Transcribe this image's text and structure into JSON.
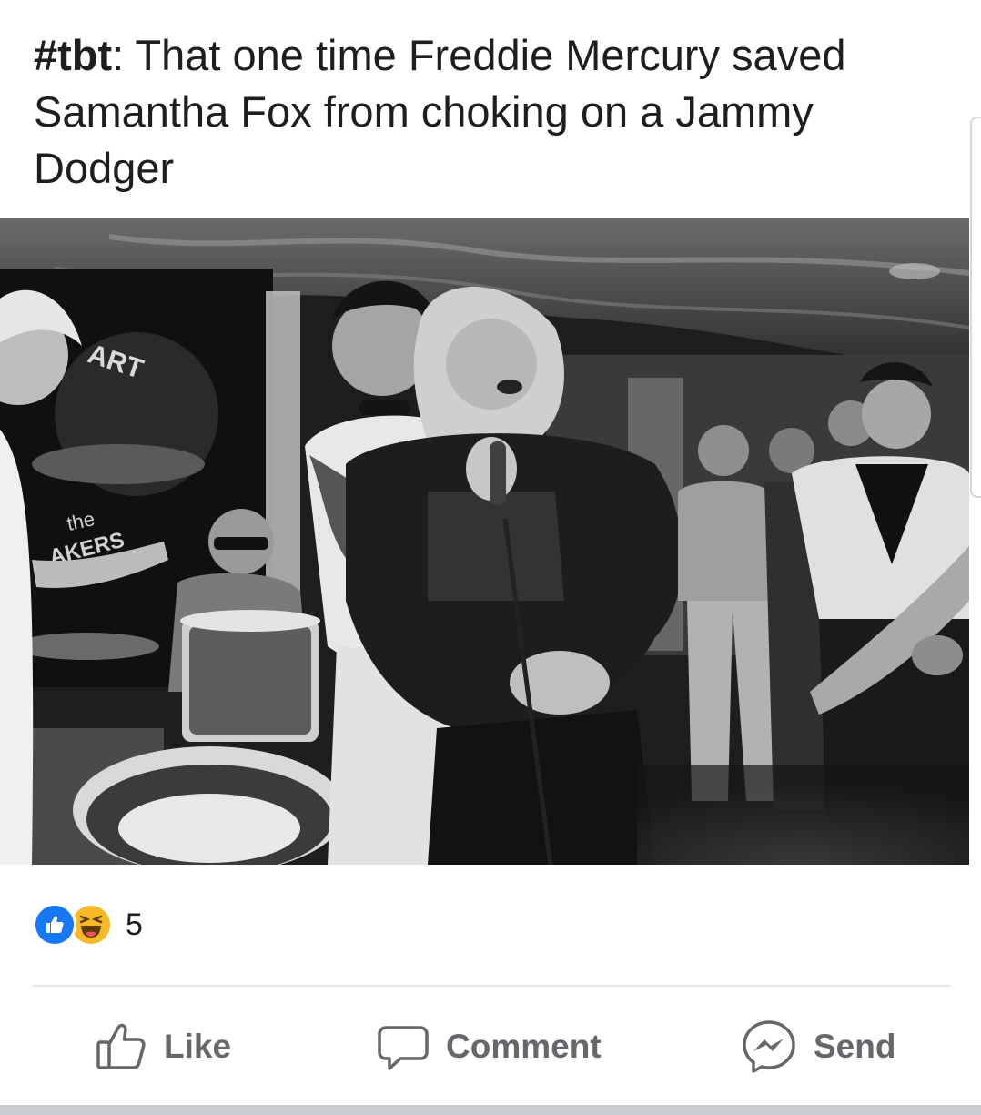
{
  "post": {
    "hashtag": "#tbt",
    "title_rest": ": That one time Freddie Mercury saved Samantha Fox from choking on a Jammy Dodger"
  },
  "photo": {
    "signage_top": "ART",
    "signage_mid": "the",
    "signage_bottom": "AKERS"
  },
  "reactions": {
    "icons": [
      "like-reaction-icon",
      "haha-reaction-icon"
    ],
    "count": "5"
  },
  "actions": {
    "like_label": "Like",
    "comment_label": "Comment",
    "send_label": "Send"
  },
  "colors": {
    "like_blue": "#1877f2",
    "haha_yellow": "#f7b928",
    "action_gray": "#65676b"
  }
}
